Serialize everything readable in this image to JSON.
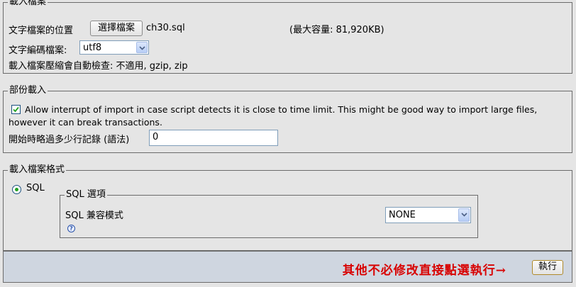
{
  "upload": {
    "legend": "載入檔案",
    "location_label": "文字檔案的位置",
    "browse_button": "選擇檔案",
    "file_name": "ch30.sql",
    "max_size": "(最大容量: 81,920KB)",
    "encoding_label": "文字編碼檔案:",
    "encoding_value": "utf8",
    "compression_text": "載入檔案壓縮會自動檢查: 不適用, gzip, zip"
  },
  "partial": {
    "legend": "部份載入",
    "interrupt_checked": true,
    "interrupt_text_line1": "Allow interrupt of import in case script detects it is close to time limit. This might be good way to import large files,",
    "interrupt_text_line2": "however it can break transactions.",
    "skip_label": "開始時略過多少行記錄 (語法)",
    "skip_value": "0"
  },
  "format": {
    "legend": "載入檔案格式",
    "sql_radio_label": "SQL",
    "sql_selected": true,
    "options_legend": "SQL 選項",
    "compat_label": "SQL 兼容模式",
    "compat_value": "NONE",
    "help_glyph": "?"
  },
  "footer": {
    "note": "其他不必修改直接點選執行→",
    "go_button": "執行"
  },
  "colors": {
    "background": "#e5e5e5",
    "footer_bg": "#cfd6e0",
    "note_red": "#d80000"
  }
}
